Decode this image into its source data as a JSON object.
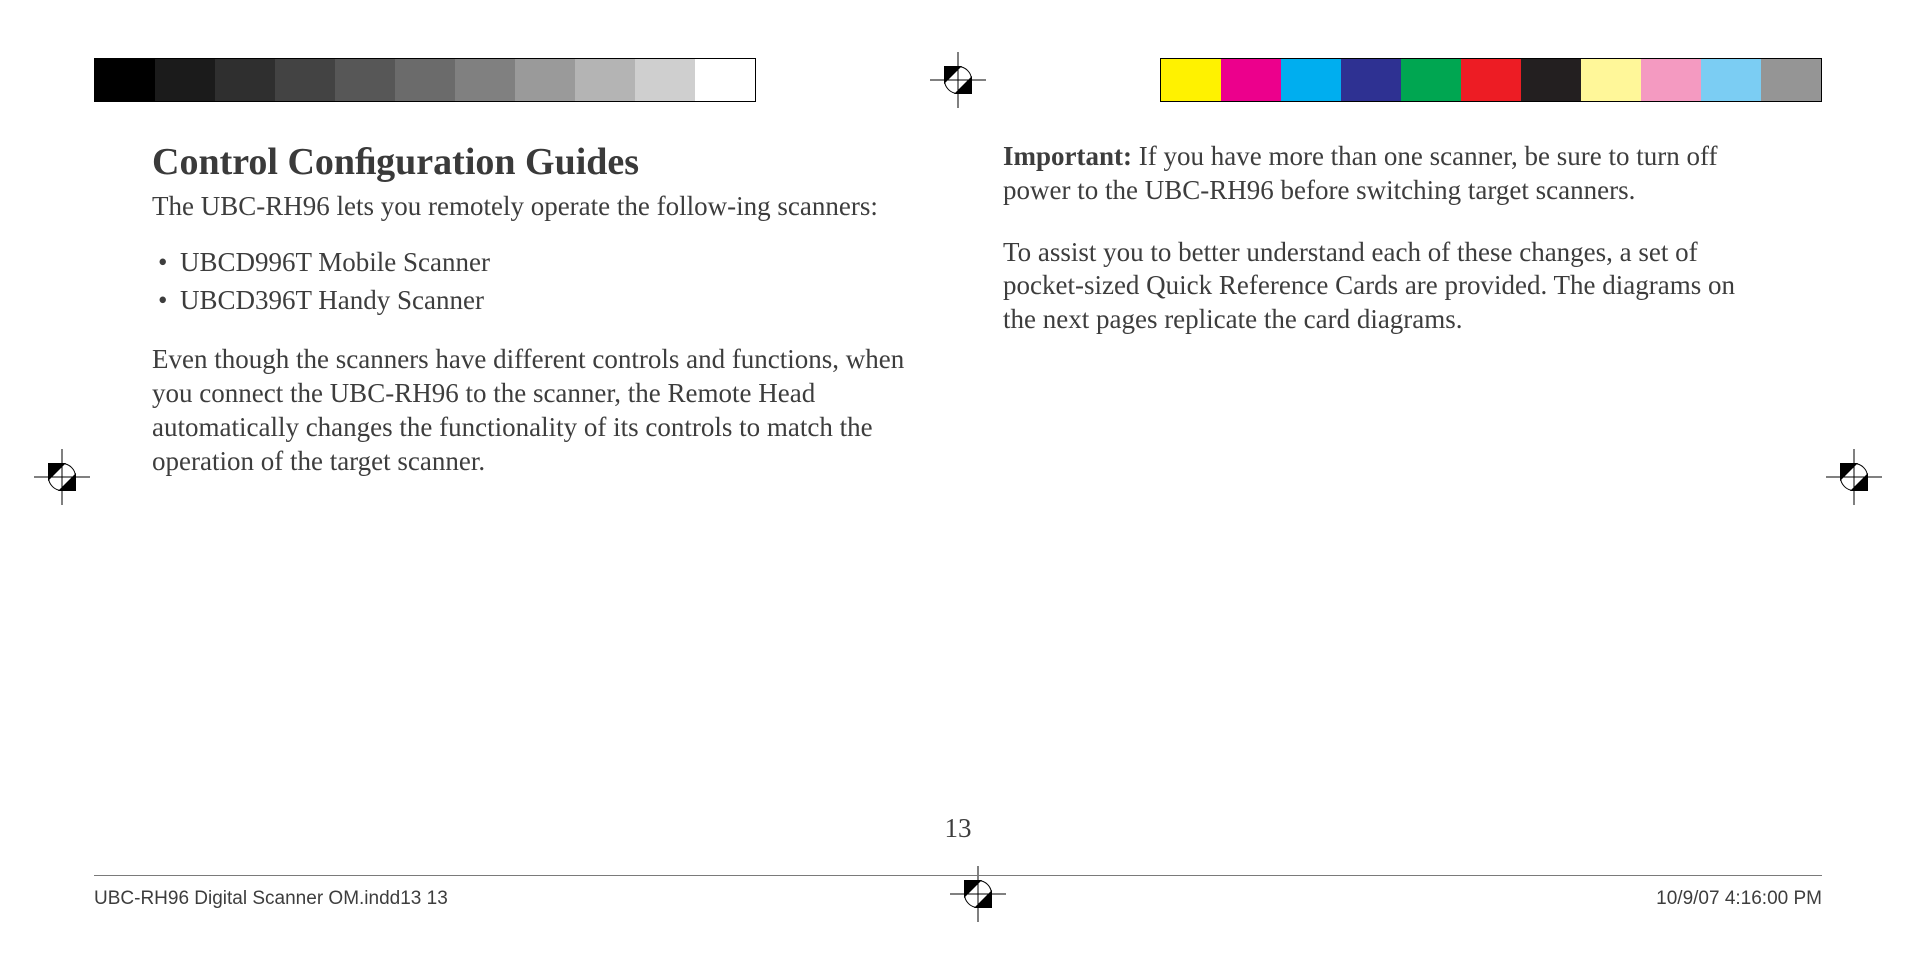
{
  "grayscale": [
    "#000000",
    "#1b1b1b",
    "#2f2f2f",
    "#434343",
    "#575757",
    "#6b6b6b",
    "#808080",
    "#9a9a9a",
    "#b4b4b4",
    "#cfcfcf",
    "#ffffff"
  ],
  "colorbar": [
    "#fff200",
    "#ec008c",
    "#00aeef",
    "#2e3192",
    "#00a651",
    "#ed1c24",
    "#231f20",
    "#fff799",
    "#f49ac1",
    "#7bcdf3",
    "#959595"
  ],
  "left": {
    "heading": "Control Conﬁguration Guides",
    "intro": "The UBC-RH96 lets you remotely operate the follow-ing scanners:",
    "bullets": [
      "UBCD996T Mobile Scanner",
      "UBCD396T Handy Scanner"
    ],
    "para1": "Even though the scanners have different controls and functions, when you connect the UBC-RH96 to the scanner, the Remote Head automatically changes the functionality of its controls to match the operation of the target scanner."
  },
  "right": {
    "important_label": "Important:",
    "important_text": " If you have more than one scanner, be sure to turn off power to the UBC-RH96 before switching target scanners.",
    "para2": "To assist you to better understand each of these changes, a set of pocket-sized Quick Reference Cards are provided. The diagrams on the next pages replicate the card diagrams."
  },
  "page_number": "13",
  "footer": {
    "left": "UBC-RH96 Digital Scanner OM.indd13   13",
    "right": "10/9/07   4:16:00 PM"
  }
}
